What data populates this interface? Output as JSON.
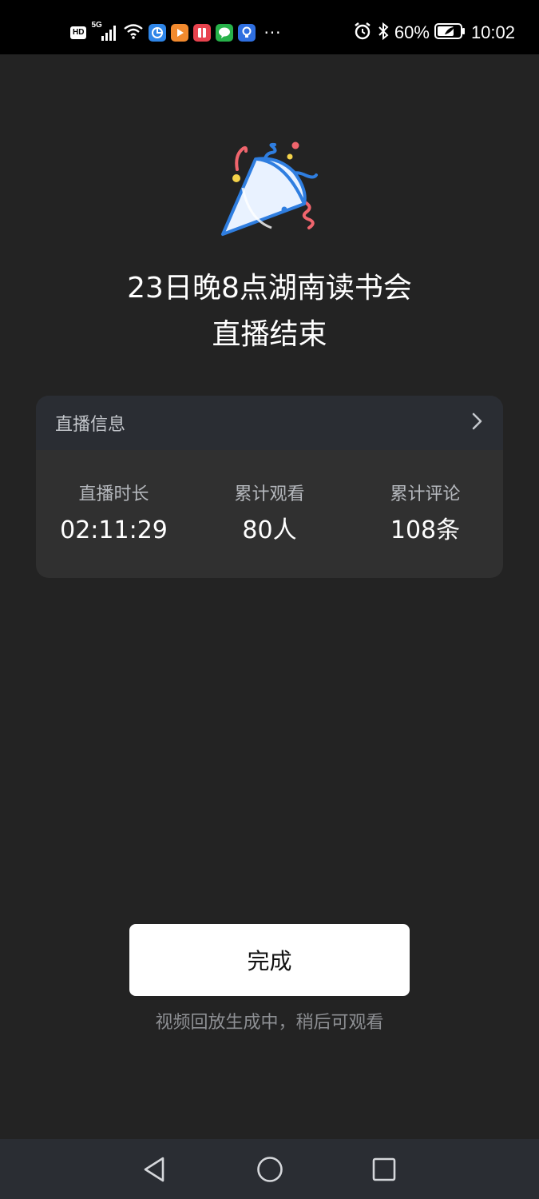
{
  "status_bar": {
    "hd": "HD",
    "network": "5G",
    "more": "···",
    "battery_percent": "60%",
    "time": "10:02",
    "icons": [
      "hd-icon",
      "signal-icon",
      "wifi-icon",
      "app-icon-blue",
      "app-icon-orange",
      "app-icon-red",
      "app-icon-green",
      "app-icon-lightbulb",
      "alarm-icon",
      "bluetooth-icon",
      "battery-icon"
    ]
  },
  "main": {
    "icon": "party-popper-icon",
    "title_line1": "23日晚8点湖南读书会",
    "title_line2": "直播结束"
  },
  "info_card": {
    "header": "直播信息",
    "stats": [
      {
        "label": "直播时长",
        "value": "02:11:29"
      },
      {
        "label": "累计观看",
        "value": "80人"
      },
      {
        "label": "累计评论",
        "value": "108条"
      }
    ]
  },
  "footer": {
    "done_label": "完成",
    "hint": "视频回放生成中，稍后可观看"
  },
  "nav_bar": {
    "icons": [
      "back-icon",
      "home-icon",
      "recents-icon"
    ]
  },
  "colors": {
    "background": "#232323",
    "card": "#303030",
    "card_header": "#2a2d33",
    "button": "#ffffff",
    "accent_blue": "#2f7ee0",
    "accent_red": "#f0656d",
    "accent_yellow": "#f5d34a"
  }
}
